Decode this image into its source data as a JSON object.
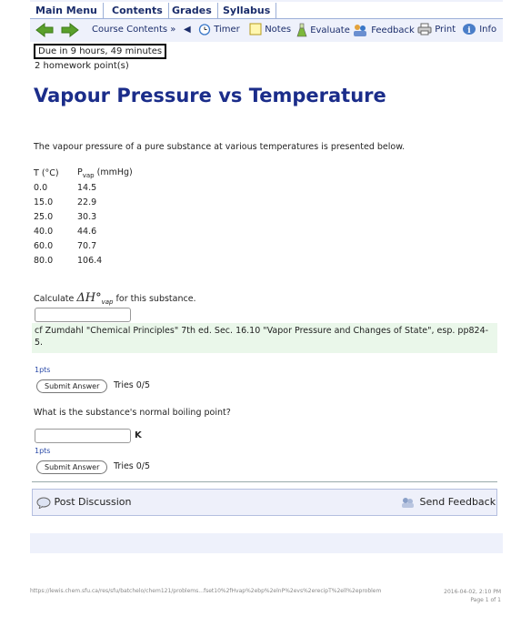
{
  "menu": {
    "items": [
      "Main Menu",
      "Contents",
      "Grades",
      "Syllabus"
    ]
  },
  "toolbar": {
    "course_contents": "Course Contents",
    "course_contents_arrow": "»",
    "timer": "Timer",
    "notes": "Notes",
    "evaluate": "Evaluate",
    "feedback": "Feedback",
    "print": "Print",
    "info": "Info"
  },
  "header": {
    "due": "Due in 9 hours, 49 minutes",
    "points": "2 homework point(s)",
    "title": "Vapour Pressure vs Temperature"
  },
  "problem": {
    "intro": "The vapour pressure of a pure substance at various temperatures is presented below.",
    "col_t": "T (°C)",
    "col_p": "P",
    "col_p_sub": "vap",
    "col_p_unit": " (mmHg)",
    "rows": [
      [
        "0.0",
        "14.5"
      ],
      [
        "15.0",
        "22.9"
      ],
      [
        "25.0",
        "30.3"
      ],
      [
        "40.0",
        "44.6"
      ],
      [
        "60.0",
        "70.7"
      ],
      [
        "80.0",
        "106.4"
      ]
    ],
    "q1_prefix": "Calculate ",
    "q1_symbol": "ΔH°",
    "q1_sub": "vap",
    "q1_suffix": " for this substance.",
    "note": "cf Zumdahl \"Chemical Principles\" 7th ed. Sec. 16.10 \"Vapor Pressure and Changes of State\", esp. pp824-5.",
    "q1_pts": "1pts",
    "submit_label": "Submit Answer",
    "q1_tries": "Tries 0/5",
    "q2": "What is the substance's normal boiling point?",
    "q2_unit": "K",
    "q2_pts": "1pts",
    "q2_tries": "Tries 0/5"
  },
  "discussion": {
    "post": "Post Discussion",
    "send": "Send Feedback"
  },
  "footer": {
    "url": "https://lewis.chem.sfu.ca/res/sfu/batchelo/chem121/problems...fset10%2fHvap%2ebp%2elnP%2evs%2erecipT%2ell%2eproblem",
    "date": "2016-04-02, 2:10 PM",
    "page": "Page 1 of 1"
  },
  "colors": {
    "title": "#1b2d8a",
    "note_bg": "#eaf7ea",
    "panel_bg": "#eef1fb"
  }
}
